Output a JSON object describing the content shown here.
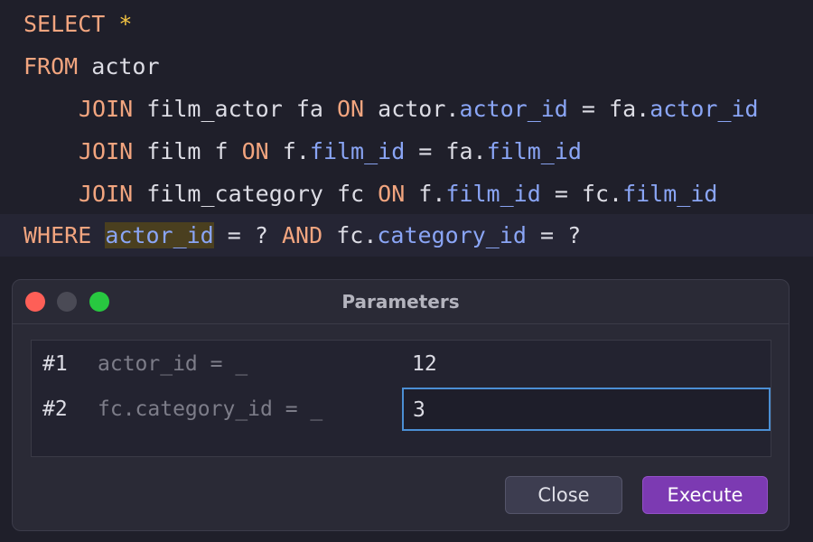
{
  "editor": {
    "lines": [
      [
        {
          "t": "SELECT ",
          "c": "kw"
        },
        {
          "t": "*",
          "c": "star"
        }
      ],
      [
        {
          "t": "FROM ",
          "c": "kw"
        },
        {
          "t": "actor",
          "c": "id"
        }
      ],
      [
        {
          "t": "JOIN ",
          "c": "kw"
        },
        {
          "t": "film_actor fa ",
          "c": "id"
        },
        {
          "t": "ON ",
          "c": "kw"
        },
        {
          "t": "actor.",
          "c": "id"
        },
        {
          "t": "actor_id",
          "c": "col"
        },
        {
          "t": " = fa.",
          "c": "id"
        },
        {
          "t": "actor_id",
          "c": "col"
        }
      ],
      [
        {
          "t": "JOIN ",
          "c": "kw"
        },
        {
          "t": "film f ",
          "c": "id"
        },
        {
          "t": "ON ",
          "c": "kw"
        },
        {
          "t": "f.",
          "c": "id"
        },
        {
          "t": "film_id",
          "c": "col"
        },
        {
          "t": " = fa.",
          "c": "id"
        },
        {
          "t": "film_id",
          "c": "col"
        }
      ],
      [
        {
          "t": "JOIN ",
          "c": "kw"
        },
        {
          "t": "film_category fc ",
          "c": "id"
        },
        {
          "t": "ON ",
          "c": "kw"
        },
        {
          "t": "f.",
          "c": "id"
        },
        {
          "t": "film_id",
          "c": "col"
        },
        {
          "t": " = fc.",
          "c": "id"
        },
        {
          "t": "film_id",
          "c": "col"
        }
      ],
      [
        {
          "t": "WHERE ",
          "c": "kw"
        },
        {
          "t": "actor_id",
          "c": "col hl"
        },
        {
          "t": " = ? ",
          "c": "id"
        },
        {
          "t": "AND ",
          "c": "kw"
        },
        {
          "t": "fc.",
          "c": "id"
        },
        {
          "t": "category_id",
          "c": "col"
        },
        {
          "t": " = ?",
          "c": "id"
        }
      ]
    ]
  },
  "dialog": {
    "title": "Parameters",
    "params": [
      {
        "num": "#1",
        "expr": "actor_id = _",
        "value": "12"
      },
      {
        "num": "#2",
        "expr": "fc.category_id = _",
        "value": "3"
      }
    ],
    "close_label": "Close",
    "execute_label": "Execute"
  },
  "colors": {
    "keyword": "#f2a57f",
    "column": "#8aa5f5",
    "star": "#f5c542",
    "execute_button": "#7c3ab2",
    "focus_border": "#4b8fd4"
  }
}
